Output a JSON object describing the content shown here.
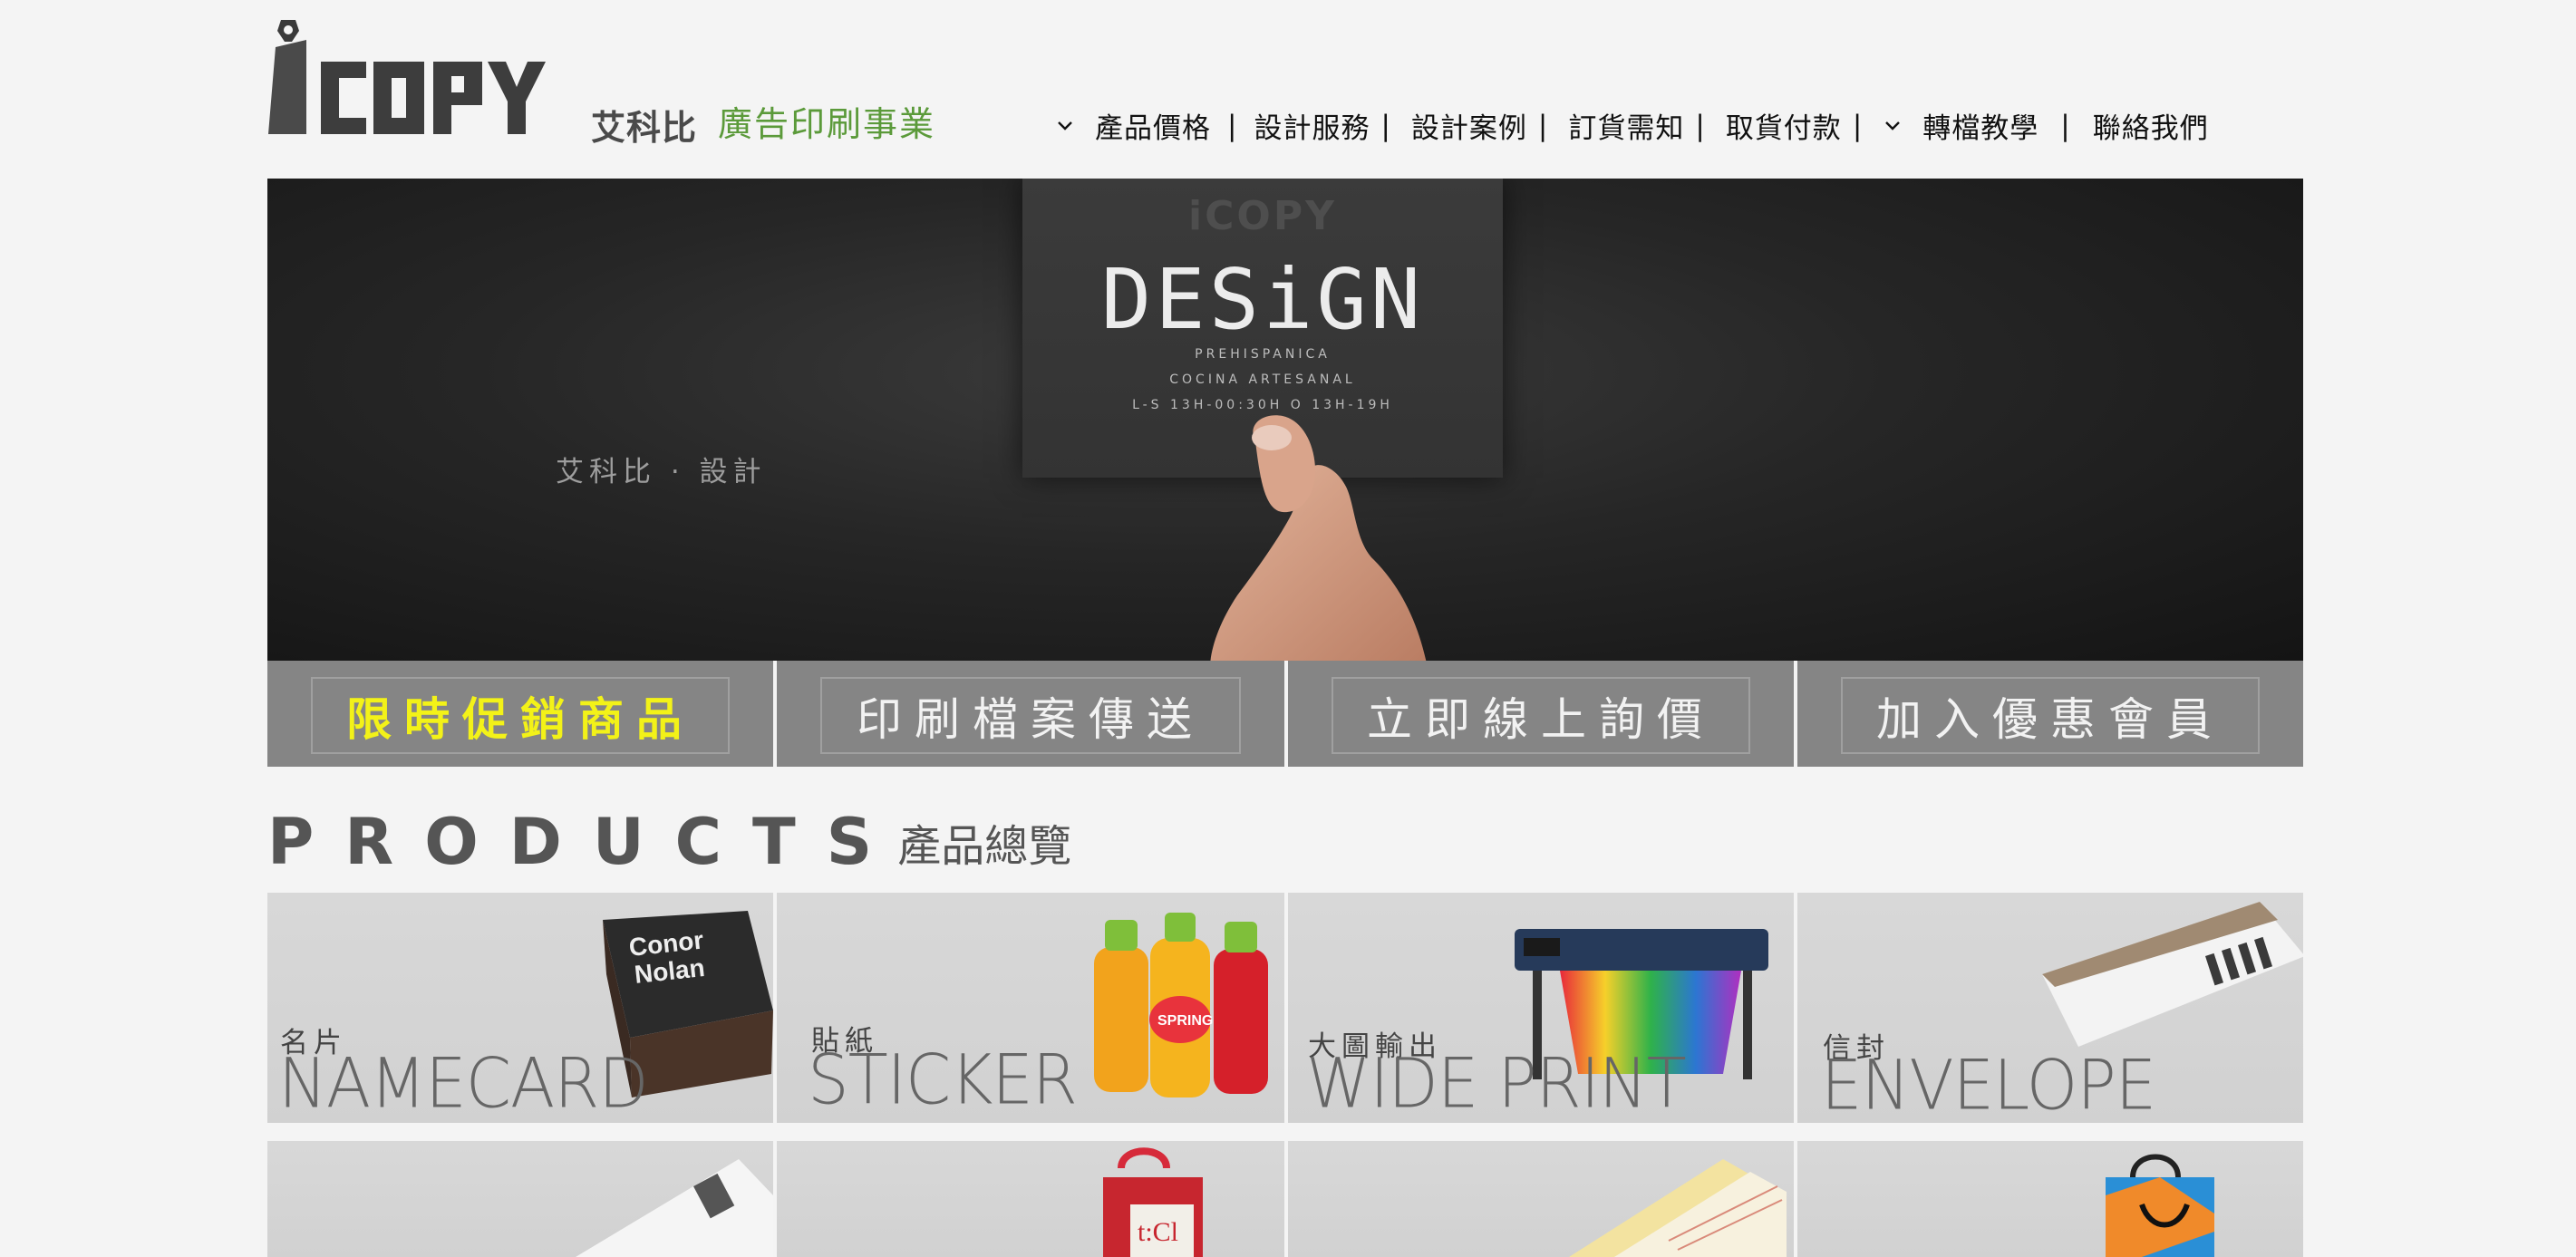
{
  "header": {
    "logo_text": "iCOPY",
    "logo_cn": "艾科比",
    "logo_subtitle": "廣告印刷事業"
  },
  "nav": {
    "items": [
      {
        "label": "產品價格",
        "dropdown": true
      },
      {
        "label": "設計服務",
        "dropdown": false
      },
      {
        "label": "設計案例",
        "dropdown": false
      },
      {
        "label": "訂貨需知",
        "dropdown": false
      },
      {
        "label": "取貨付款",
        "dropdown": false
      },
      {
        "label": "轉檔教學",
        "dropdown": true
      },
      {
        "label": "聯絡我們",
        "dropdown": false
      }
    ],
    "separator": "|"
  },
  "hero": {
    "card_brand": "iCOPY",
    "card_title": "DESiGN",
    "card_lines": [
      "PREHISPANICA",
      "COCINA ARTESANAL",
      "L-S 13H-00:30H O 13H-19H"
    ],
    "caption": "艾科比 · 設計"
  },
  "promos": [
    {
      "label": "限時促銷商品",
      "highlight": true
    },
    {
      "label": "印刷檔案傳送",
      "highlight": false
    },
    {
      "label": "立即線上詢價",
      "highlight": false
    },
    {
      "label": "加入優惠會員",
      "highlight": false
    }
  ],
  "products": {
    "title_en": "PRODUCTS",
    "title_cn": "產品總覽",
    "tiles": [
      {
        "cn": "名片",
        "en": "NAMECARD"
      },
      {
        "cn": "貼紙",
        "en": "STICKER"
      },
      {
        "cn": "大圖輸出",
        "en": "WIDE PRINT"
      },
      {
        "cn": "信封",
        "en": "ENVELOPE"
      },
      {
        "cn": "",
        "en": ""
      },
      {
        "cn": "",
        "en": ""
      },
      {
        "cn": "",
        "en": ""
      },
      {
        "cn": "",
        "en": ""
      }
    ]
  },
  "colors": {
    "accent_green": "#5b9a3a",
    "promo_bg": "#858585",
    "promo_highlight": "#f3f218"
  }
}
